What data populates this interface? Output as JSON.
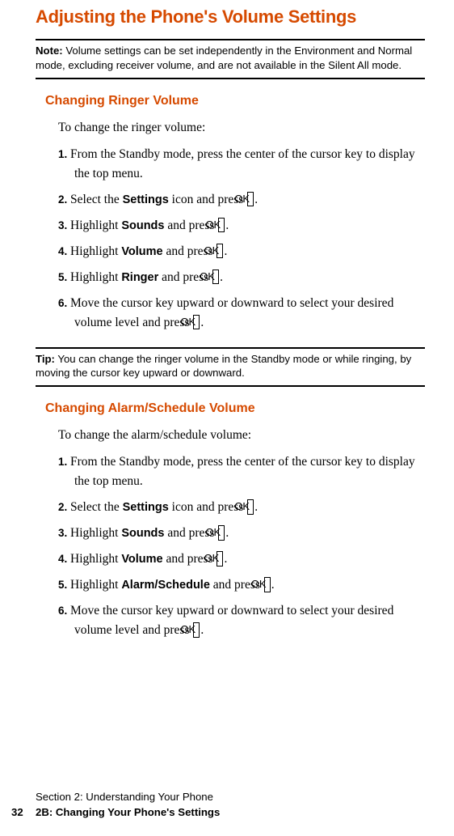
{
  "title": "Adjusting the Phone's Volume Settings",
  "note": {
    "label": "Note:",
    "text": " Volume settings can be set independently in the Environment and Normal mode, excluding receiver volume, and are not available in the Silent All mode."
  },
  "section1": {
    "heading": "Changing Ringer Volume",
    "intro": "To change the ringer volume:",
    "steps": [
      {
        "num": "1.",
        "pre": "From the Standby mode, press the center of the cursor key to display the top menu."
      },
      {
        "num": "2.",
        "pre": "Select the ",
        "bold": "Settings",
        "mid": " icon and press ",
        "ok": "OK",
        "post": "."
      },
      {
        "num": "3.",
        "pre": "Highlight ",
        "bold": "Sounds",
        "mid": " and press ",
        "ok": "OK",
        "post": "."
      },
      {
        "num": "4.",
        "pre": "Highlight ",
        "bold": "Volume",
        "mid": " and press ",
        "ok": "OK",
        "post": "."
      },
      {
        "num": "5.",
        "pre": "Highlight ",
        "bold": "Ringer",
        "mid": " and press ",
        "ok": "OK",
        "post": "."
      },
      {
        "num": "6.",
        "pre": "Move the cursor key upward or downward to select your desired volume level and press ",
        "ok": "OK",
        "post": "."
      }
    ]
  },
  "tip": {
    "label": "Tip:",
    "text": " You can change the ringer volume in the Standby mode or while ringing, by moving the cursor key upward or downward."
  },
  "section2": {
    "heading": "Changing Alarm/Schedule Volume",
    "intro": "To change the alarm/schedule volume:",
    "steps": [
      {
        "num": "1.",
        "pre": "From the Standby mode, press the center of the cursor key to display the top menu."
      },
      {
        "num": "2.",
        "pre": "Select the ",
        "bold": "Settings",
        "mid": " icon and press ",
        "ok": "OK",
        "post": "."
      },
      {
        "num": "3.",
        "pre": "Highlight ",
        "bold": "Sounds",
        "mid": " and press ",
        "ok": "OK",
        "post": "."
      },
      {
        "num": "4.",
        "pre": "Highlight ",
        "bold": "Volume",
        "mid": " and press ",
        "ok": "OK",
        "post": "."
      },
      {
        "num": "5.",
        "pre": "Highlight ",
        "bold": "Alarm/Schedule",
        "mid": " and press ",
        "ok": "OK",
        "post": "."
      },
      {
        "num": "6.",
        "pre": "Move the cursor key upward or downward to select your desired volume level and press ",
        "ok": "OK",
        "post": "."
      }
    ]
  },
  "footer": {
    "line1": "Section 2: Understanding Your Phone",
    "pagenum": "32",
    "line2": "2B: Changing Your Phone's Settings"
  }
}
